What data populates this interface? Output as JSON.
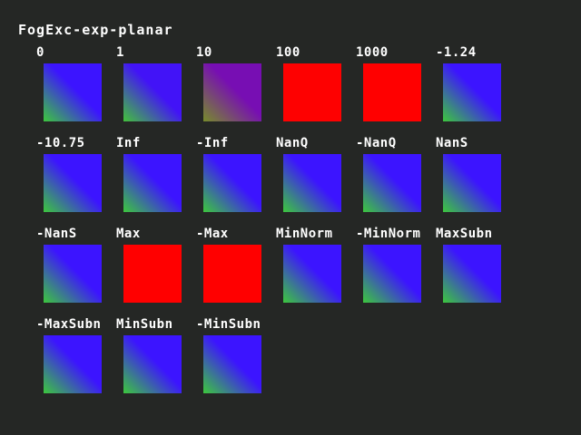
{
  "title": "FogExc-exp-planar",
  "palette": {
    "background": "#252725",
    "text": "#ffffff",
    "fog_red": "#ff0000",
    "gradient_green": "#3cc83c",
    "gradient_blue": "#3c14ff"
  },
  "cells": [
    {
      "label": "0",
      "fog": 0
    },
    {
      "label": "1",
      "fog": 0.03
    },
    {
      "label": "10",
      "fog": 0.3
    },
    {
      "label": "100",
      "fog": 0.95
    },
    {
      "label": "1000",
      "fog": 1
    },
    {
      "label": "-1.24",
      "fog": 0
    },
    {
      "label": "-10.75",
      "fog": 0
    },
    {
      "label": "Inf",
      "fog": 0
    },
    {
      "label": "-Inf",
      "fog": 0
    },
    {
      "label": "NanQ",
      "fog": 0
    },
    {
      "label": "-NanQ",
      "fog": 0
    },
    {
      "label": "NanS",
      "fog": 0
    },
    {
      "label": "-NanS",
      "fog": 0
    },
    {
      "label": "Max",
      "fog": 1
    },
    {
      "label": "-Max",
      "fog": 1
    },
    {
      "label": "MinNorm",
      "fog": 0
    },
    {
      "label": "-MinNorm",
      "fog": 0
    },
    {
      "label": "MaxSubn",
      "fog": 0
    },
    {
      "label": "-MaxSubn",
      "fog": 0
    },
    {
      "label": "MinSubn",
      "fog": 0
    },
    {
      "label": "-MinSubn",
      "fog": 0
    }
  ]
}
